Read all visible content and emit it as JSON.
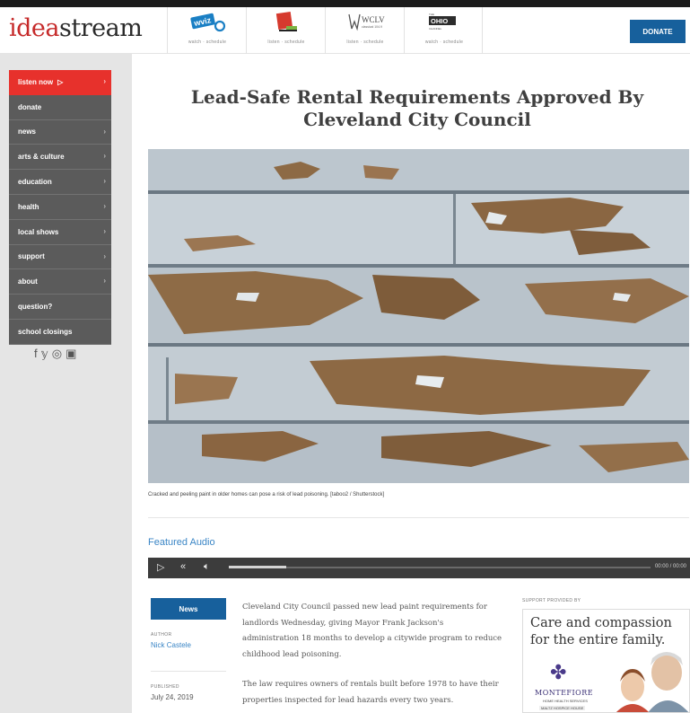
{
  "header": {
    "logo": {
      "part1": "idea",
      "part2": "stream"
    },
    "stations": [
      {
        "name": "wviz",
        "icon": "wviz-logo-icon",
        "links": "watch · schedule"
      },
      {
        "name": "ideastream channel",
        "icon": "channel-logo-icon",
        "links": "listen · schedule"
      },
      {
        "name": "WCLV",
        "icon": "wclv-logo-icon",
        "links": "listen · schedule"
      },
      {
        "name": "The Ohio Channel",
        "icon": "ohio-channel-logo-icon",
        "links": "watch · schedule"
      }
    ],
    "donate_label": "DONATE"
  },
  "sidebar": {
    "items": [
      {
        "label": "listen now",
        "active": true,
        "chevron": "›"
      },
      {
        "label": "donate",
        "chevron": ""
      },
      {
        "label": "news",
        "chevron": "›"
      },
      {
        "label": "arts & culture",
        "chevron": "›"
      },
      {
        "label": "education",
        "chevron": "›"
      },
      {
        "label": "health",
        "chevron": "›"
      },
      {
        "label": "local shows",
        "chevron": "›"
      },
      {
        "label": "support",
        "chevron": "›"
      },
      {
        "label": "about",
        "chevron": "›"
      },
      {
        "label": "question?",
        "chevron": ""
      },
      {
        "label": "school closings",
        "chevron": ""
      }
    ],
    "social": [
      "f",
      "𝕪",
      "◎",
      "▣"
    ]
  },
  "article": {
    "title": "Lead-Safe Rental Requirements Approved By Cleveland City Council",
    "caption": "Cracked and peeling paint in older homes can pose a risk of lead poisoning. [taboo2 / Shutterstock]",
    "featured_audio": "Featured Audio",
    "player": {
      "time": "00:00 / 00:00"
    },
    "category": "News",
    "author_label": "AUTHOR",
    "author": "Nick Castele",
    "published_label": "PUBLISHED",
    "published": "July 24, 2019",
    "paragraphs": [
      "Cleveland City Council passed new lead paint requirements for landlords Wednesday, giving Mayor Frank Jackson's administration 18 months to develop a citywide program to reduce childhood lead poisoning.",
      "The law requires owners of rentals built before 1978 to have their properties inspected for lead hazards every two years."
    ]
  },
  "sponsor": {
    "label": "SUPPORT PROVIDED BY",
    "headline": "Care and compassion for the entire family.",
    "brand": "MONTEFIORE",
    "sub1": "HOME HEALTH SERVICES",
    "sub2": "MALTZ HOSPICE HOUSE"
  },
  "colors": {
    "accent_red": "#e7312c",
    "brand_blue": "#17609c",
    "link_blue": "#3b86c6",
    "nav_gray": "#5b5b5b"
  }
}
